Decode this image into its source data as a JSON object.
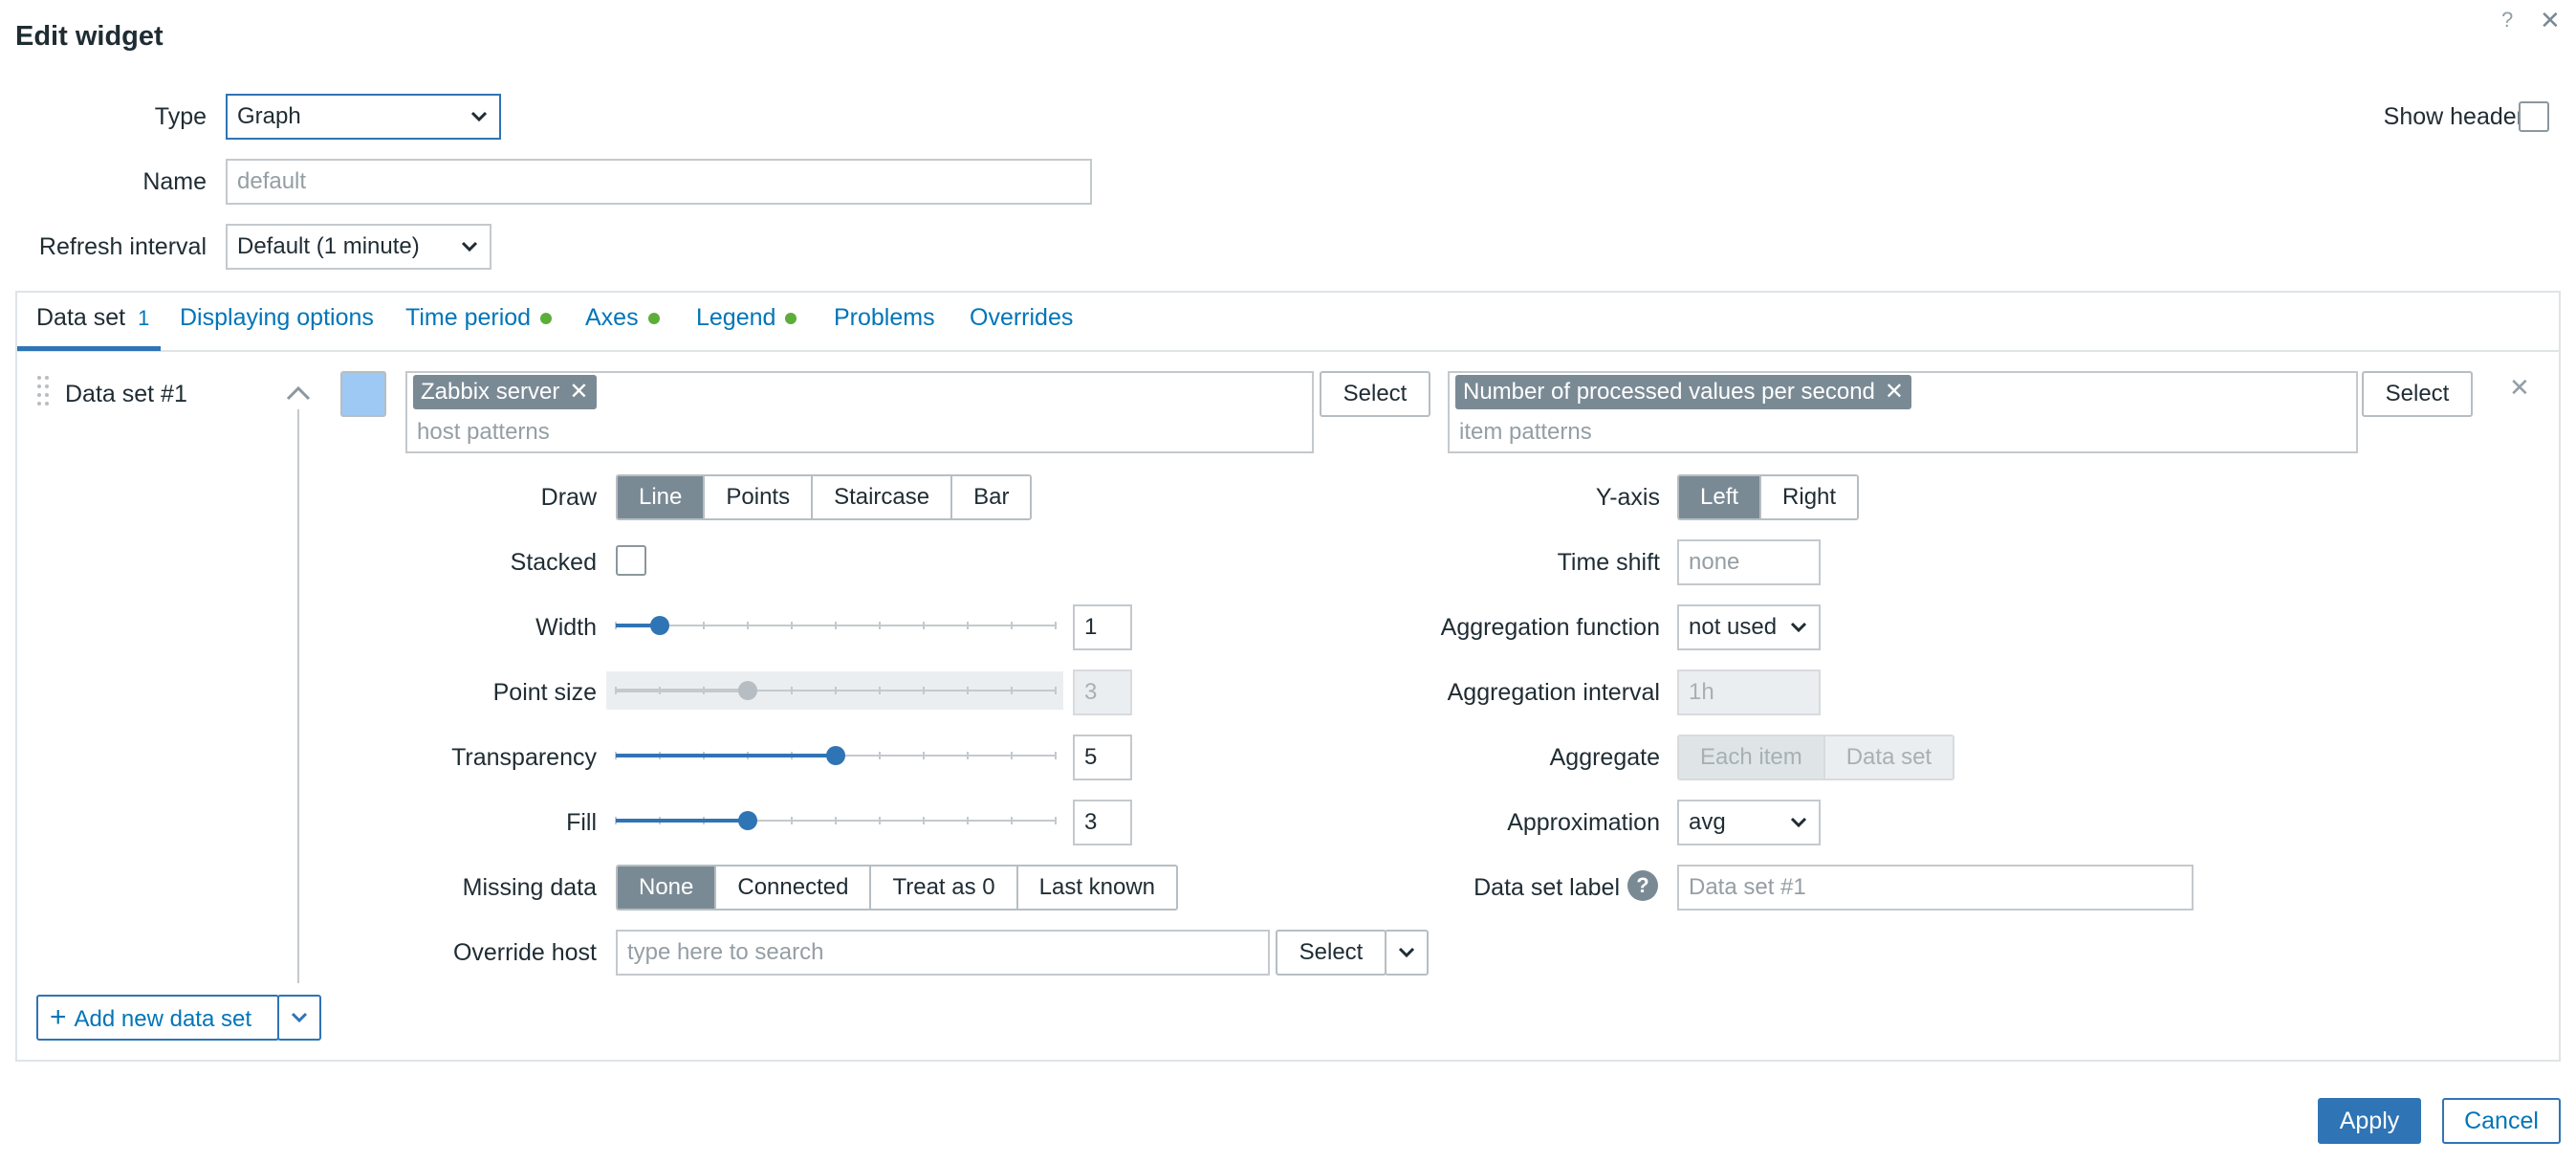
{
  "dialog": {
    "title": "Edit widget",
    "help_glyph": "?",
    "close_glyph": "✕"
  },
  "header": {
    "type_label": "Type",
    "type_value": "Graph",
    "name_label": "Name",
    "name_placeholder": "default",
    "refresh_label": "Refresh interval",
    "refresh_value": "Default (1 minute)",
    "show_header_label": "Show header"
  },
  "tabs": [
    {
      "label": "Data set",
      "badge": "1"
    },
    {
      "label": "Displaying options"
    },
    {
      "label": "Time period"
    },
    {
      "label": "Axes"
    },
    {
      "label": "Legend"
    },
    {
      "label": "Problems"
    },
    {
      "label": "Overrides"
    }
  ],
  "dataset": {
    "name": "Data set #1",
    "color": "#9ec9f5",
    "host_chip": "Zabbix server",
    "host_placeholder": "host patterns",
    "item_chip": "Number of processed values per second",
    "item_placeholder": "item patterns",
    "select_label": "Select",
    "remove_glyph": "✕"
  },
  "left": {
    "draw_label": "Draw",
    "draw_options": [
      "Line",
      "Points",
      "Staircase",
      "Bar"
    ],
    "draw_selected": "Line",
    "stacked_label": "Stacked",
    "width_label": "Width",
    "width_value": "1",
    "pointsize_label": "Point size",
    "pointsize_value": "3",
    "transparency_label": "Transparency",
    "transparency_value": "5",
    "fill_label": "Fill",
    "fill_value": "3",
    "missing_label": "Missing data",
    "missing_options": [
      "None",
      "Connected",
      "Treat as 0",
      "Last known"
    ],
    "missing_selected": "None",
    "override_label": "Override host",
    "override_placeholder": "type here to search",
    "override_select": "Select"
  },
  "right": {
    "yaxis_label": "Y-axis",
    "yaxis_options": [
      "Left",
      "Right"
    ],
    "yaxis_selected": "Left",
    "timeshift_label": "Time shift",
    "timeshift_placeholder": "none",
    "aggfunc_label": "Aggregation function",
    "aggfunc_value": "not used",
    "agginterval_label": "Aggregation interval",
    "agginterval_placeholder": "1h",
    "aggregate_label": "Aggregate",
    "aggregate_options": [
      "Each item",
      "Data set"
    ],
    "approx_label": "Approximation",
    "approx_value": "avg",
    "dslabel_label": "Data set label",
    "dslabel_placeholder": "Data set #1"
  },
  "add_dataset_label": "Add new data set",
  "footer": {
    "apply": "Apply",
    "cancel": "Cancel"
  }
}
